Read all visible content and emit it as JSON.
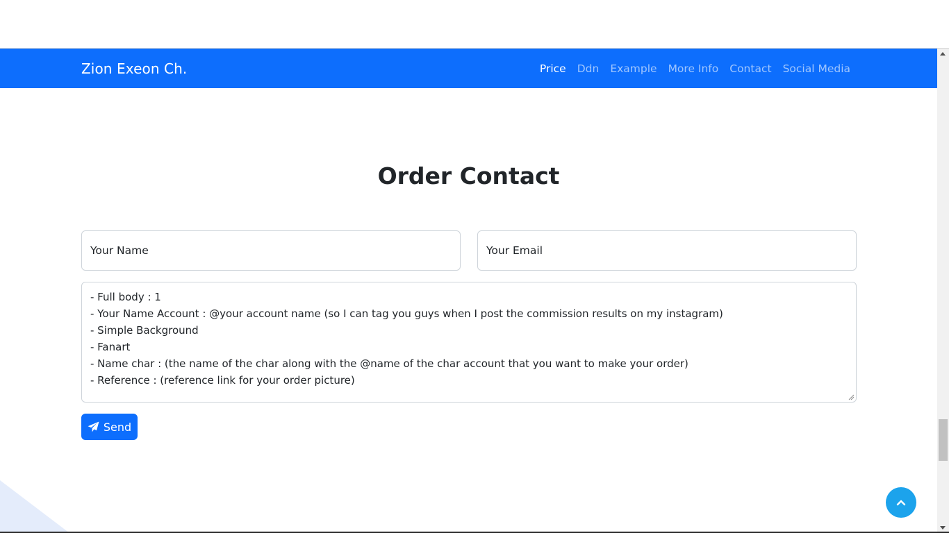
{
  "navbar": {
    "brand": "Zion Exeon Ch.",
    "links": [
      {
        "label": "Price",
        "active": true
      },
      {
        "label": "Ddn",
        "active": false
      },
      {
        "label": "Example",
        "active": false
      },
      {
        "label": "More Info",
        "active": false
      },
      {
        "label": "Contact",
        "active": false
      },
      {
        "label": "Social Media",
        "active": false
      }
    ]
  },
  "contact": {
    "title": "Order Contact",
    "name_placeholder": "Your Name",
    "email_placeholder": "Your Email",
    "message_lines": [
      "- Full body : 1",
      "- Your Name Account : @your account name (so I can tag you guys when I post the commission results on my instagram)",
      "- Simple Background",
      "- Fanart",
      "- Name char : (the name of the char along with the @name of the char account that you want to make your order)",
      "- Reference : (reference link for your order picture)"
    ],
    "send_label": "Send",
    "send_icon": "paper-plane-icon"
  },
  "scroll_top_icon": "chevron-up-icon",
  "colors": {
    "primary": "#0d6efd",
    "scroll_top": "#1ca3ec",
    "text": "#212529"
  }
}
